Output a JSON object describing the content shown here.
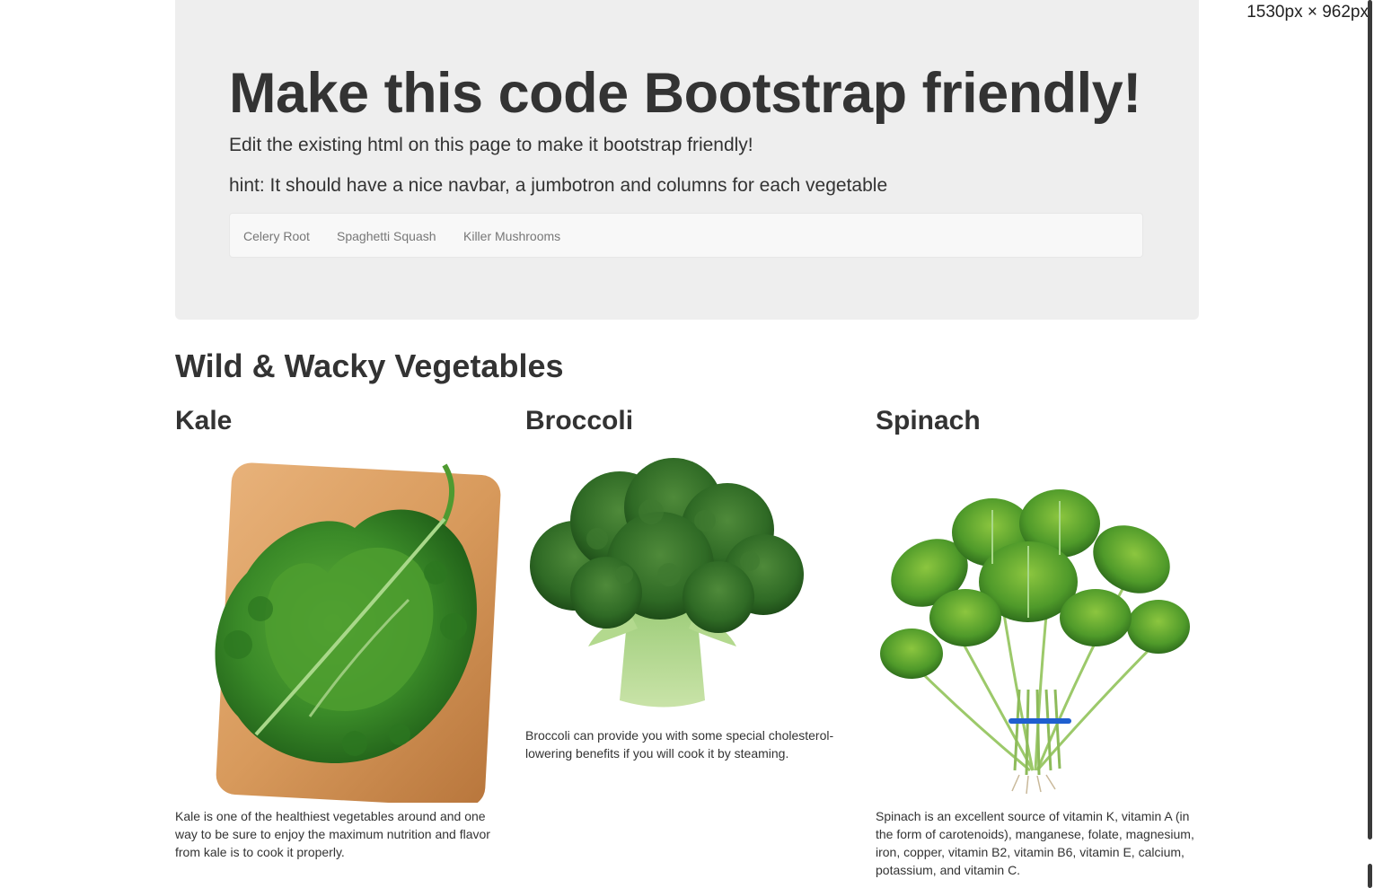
{
  "viewport_readout": "1530px × 962px",
  "jumbotron": {
    "title": "Make this code Bootstrap friendly!",
    "lead_1": "Edit the existing html on this page to make it bootstrap friendly!",
    "lead_2": "hint: It should have a nice navbar, a jumbotron and columns for each vegetable"
  },
  "navbar": {
    "links": [
      "Celery Root",
      "Spaghetti Squash",
      "Killer Mushrooms"
    ]
  },
  "section": {
    "title": "Wild & Wacky Vegetables"
  },
  "vegetables": [
    {
      "name": "Kale",
      "image": "kale-on-cutting-board",
      "description": "Kale is one of the healthiest vegetables around and one way to be sure to enjoy the maximum nutrition and flavor from kale is to cook it properly."
    },
    {
      "name": "Broccoli",
      "image": "broccoli-head",
      "description": "Broccoli can provide you with some special cholesterol-lowering benefits if you will cook it by steaming."
    },
    {
      "name": "Spinach",
      "image": "spinach-bunch",
      "description": "Spinach is an excellent source of vitamin K, vitamin A (in the form of carotenoids), manganese, folate, magnesium, iron, copper, vitamin B2, vitamin B6, vitamin E, calcium, potassium, and vitamin C."
    }
  ],
  "colors": {
    "jumbotron_bg": "#eeeeee",
    "navbar_bg": "#f8f8f8",
    "text": "#333333",
    "nav_link": "#777777"
  }
}
